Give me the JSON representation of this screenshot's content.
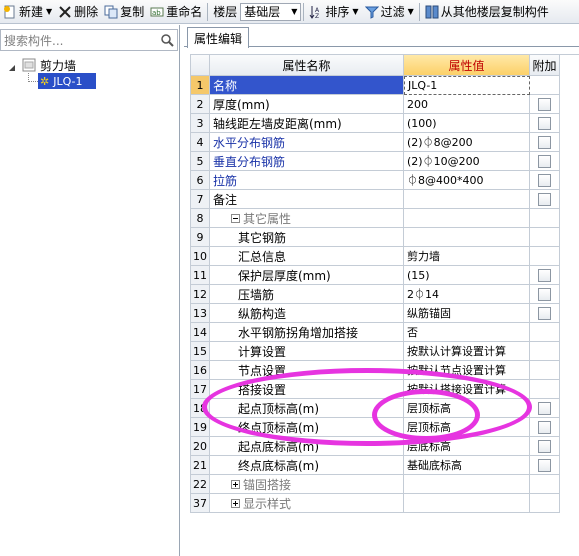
{
  "toolbar": {
    "new": "新建",
    "delete": "删除",
    "copy": "复制",
    "rename": "重命名",
    "floor_label": "楼层",
    "floor_value": "基础层",
    "sort": "排序",
    "filter": "过滤",
    "copy_from_other": "从其他楼层复制构件"
  },
  "search": {
    "placeholder": "搜索构件..."
  },
  "tree": {
    "root": "剪力墙",
    "child": "JLQ-1"
  },
  "tab": {
    "label": "属性编辑"
  },
  "table": {
    "headers": [
      "属性名称",
      "属性值",
      "附加"
    ],
    "rows": [
      {
        "no": "1",
        "name": "名称",
        "value": "JLQ-1"
      },
      {
        "no": "2",
        "name": "厚度(mm)",
        "value": "200"
      },
      {
        "no": "3",
        "name": "轴线距左墙皮距离(mm)",
        "value": "(100)"
      },
      {
        "no": "4",
        "name": "水平分布钢筋",
        "value": "(2)⏀8@200"
      },
      {
        "no": "5",
        "name": "垂直分布钢筋",
        "value": "(2)⏀10@200"
      },
      {
        "no": "6",
        "name": "拉筋",
        "value": "⏀8@400*400"
      },
      {
        "no": "7",
        "name": "备注",
        "value": ""
      },
      {
        "no": "8",
        "name": "其它属性",
        "value": ""
      },
      {
        "no": "9",
        "name": "其它钢筋",
        "value": ""
      },
      {
        "no": "10",
        "name": "汇总信息",
        "value": "剪力墙"
      },
      {
        "no": "11",
        "name": "保护层厚度(mm)",
        "value": "(15)"
      },
      {
        "no": "12",
        "name": "压墙筋",
        "value": "2⏀14"
      },
      {
        "no": "13",
        "name": "纵筋构造",
        "value": "纵筋锚固"
      },
      {
        "no": "14",
        "name": "水平钢筋拐角增加搭接",
        "value": "否"
      },
      {
        "no": "15",
        "name": "计算设置",
        "value": "按默认计算设置计算"
      },
      {
        "no": "16",
        "name": "节点设置",
        "value": "按默认节点设置计算"
      },
      {
        "no": "17",
        "name": "搭接设置",
        "value": "按默认搭接设置计算"
      },
      {
        "no": "18",
        "name": "起点顶标高(m)",
        "value": "层顶标高"
      },
      {
        "no": "19",
        "name": "终点顶标高(m)",
        "value": "层顶标高"
      },
      {
        "no": "20",
        "name": "起点底标高(m)",
        "value": "层底标高"
      },
      {
        "no": "21",
        "name": "终点底标高(m)",
        "value": "基础底标高"
      },
      {
        "no": "22",
        "name": "锚固搭接",
        "value": ""
      },
      {
        "no": "37",
        "name": "显示样式",
        "value": ""
      }
    ]
  },
  "colors": {
    "annotation": "#e634e0",
    "selection": "#3355cc",
    "header_value_bg": "#fcd068",
    "blue_text": "#1a33a8"
  }
}
